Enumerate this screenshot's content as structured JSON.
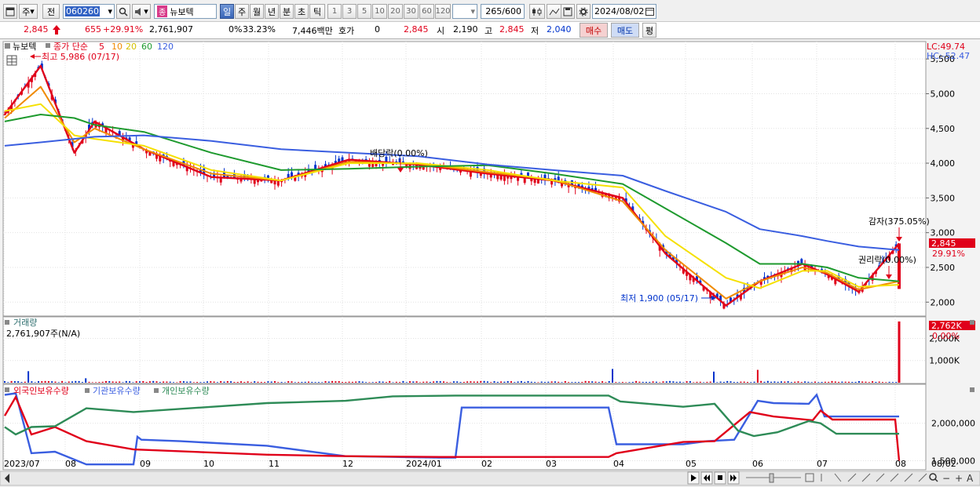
{
  "toolbar": {
    "type_label": "주",
    "prev_label": "전",
    "code": "060260",
    "badge": "종",
    "stock_name": "뉴보텍",
    "periods": [
      "일",
      "주",
      "월",
      "년",
      "분",
      "초",
      "틱"
    ],
    "active_period": "일",
    "intervals": [
      "1",
      "3",
      "5",
      "10",
      "20",
      "30",
      "60",
      "120"
    ],
    "count": "265",
    "count_total": "/600",
    "date": "2024/08/02"
  },
  "quote": {
    "price": "2,845",
    "change": "655",
    "change_pct": "+29.91%",
    "volume": "2,761,907",
    "pct1": "0%",
    "pct2": "33.23%",
    "amount": "7,446백만",
    "hoga_label": "호가",
    "hoga_value": "0",
    "hoga_price": "2,845",
    "open_label": "시",
    "open": "2,190",
    "high_label": "고",
    "high": "2,845",
    "low_label": "저",
    "low": "2,040",
    "buy_label": "매수",
    "sell_label": "매도",
    "eval_label": "평"
  },
  "colors": {
    "up": "#e0001a",
    "down": "#0033cc",
    "ma5": "#e0001a",
    "ma10": "#f08a00",
    "ma20": "#f5e000",
    "ma60": "#1e9a2e",
    "ma120": "#3a5ee0",
    "foreign": "#3a5ee0",
    "inst": "#e0001a",
    "indiv": "#2e8b57"
  },
  "chart_data": [
    {
      "type": "line",
      "title": "뉴보텍",
      "legend": {
        "label": "종가 단순",
        "periods": [
          "5",
          "10",
          "20",
          "60",
          "120"
        ]
      },
      "y_ticks": [
        "5,500",
        "5,000",
        "4,500",
        "4,000",
        "3,500",
        "3,000",
        "2,500",
        "2,000"
      ],
      "ylim": [
        1800,
        5750
      ],
      "x_labels": [
        "2023/07",
        "08",
        "09",
        "10",
        "11",
        "12",
        "2024/01",
        "02",
        "03",
        "04",
        "05",
        "06",
        "07",
        "08",
        "08/02"
      ],
      "lc": "LC:49.74",
      "hc": "HC:-52.47",
      "last_price_tag": "2,845",
      "last_pct_tag": "29.91%",
      "annotations": {
        "high": "최고 5,986 (07/17)",
        "low": "최저 1,900 (05/17)",
        "dividend": "배당락(0.00%)",
        "reduction": "감자(375.05%)",
        "rights": "권리락(0.00%)"
      },
      "series": [
        {
          "name": "5",
          "color": "#e0001a",
          "x": [
            "2023/07/01",
            "2023/07/17",
            "2023/08/01",
            "2023/08/10",
            "2023/09/01",
            "2023/10/01",
            "2023/11/01",
            "2023/12/01",
            "2024/01/01",
            "2024/02/01",
            "2024/03/01",
            "2024/04/01",
            "2024/04/20",
            "2024/05/17",
            "2024/06/01",
            "2024/06/20",
            "2024/07/01",
            "2024/07/15",
            "2024/08/02"
          ],
          "values": [
            4700,
            5400,
            4150,
            4600,
            4200,
            3800,
            3750,
            4050,
            3980,
            3850,
            3750,
            3500,
            2700,
            1950,
            2300,
            2550,
            2400,
            2150,
            2845
          ]
        },
        {
          "name": "10",
          "color": "#f08a00",
          "values": [
            4650,
            5100,
            4300,
            4500,
            4200,
            3850,
            3750,
            4020,
            3990,
            3870,
            3760,
            3450,
            2750,
            2050,
            2300,
            2500,
            2420,
            2180,
            2300
          ]
        },
        {
          "name": "20",
          "color": "#f5e000",
          "values": [
            4750,
            4850,
            4400,
            4350,
            4250,
            3900,
            3750,
            4000,
            4000,
            3900,
            3750,
            3650,
            2950,
            2350,
            2200,
            2450,
            2450,
            2220,
            2250
          ]
        },
        {
          "name": "60",
          "color": "#1e9a2e",
          "values": [
            4600,
            4700,
            4650,
            4550,
            4450,
            4150,
            3900,
            3920,
            3950,
            3970,
            3850,
            3700,
            3350,
            2850,
            2550,
            2550,
            2500,
            2350,
            2300
          ]
        },
        {
          "name": "120",
          "color": "#3a5ee0",
          "values": [
            4250,
            4300,
            4350,
            4380,
            4400,
            4320,
            4200,
            4150,
            4100,
            3980,
            3900,
            3820,
            3600,
            3300,
            3050,
            2950,
            2880,
            2800,
            2750
          ]
        }
      ]
    },
    {
      "type": "bar",
      "title": "거래량",
      "subtitle": "2,761,907주(N/A)",
      "y_ticks": [
        "2,000K",
        "1,000K"
      ],
      "last_tag": "2,762K",
      "pct_tag": "0.00%"
    },
    {
      "type": "line",
      "series": [
        {
          "name": "외국인보유수량",
          "color": "#3a5ee0"
        },
        {
          "name": "기관보유수량",
          "color": "#e0001a"
        },
        {
          "name": "개인보유수량",
          "color": "#2e8b57"
        }
      ],
      "y_ticks": [
        "2,000,000",
        "1,500,000"
      ]
    }
  ],
  "footer": {
    "nav_buttons": [
      "▶",
      "⏮",
      "⏹",
      "⏭"
    ],
    "zoom_buttons": [
      "−",
      "+",
      "A"
    ]
  }
}
